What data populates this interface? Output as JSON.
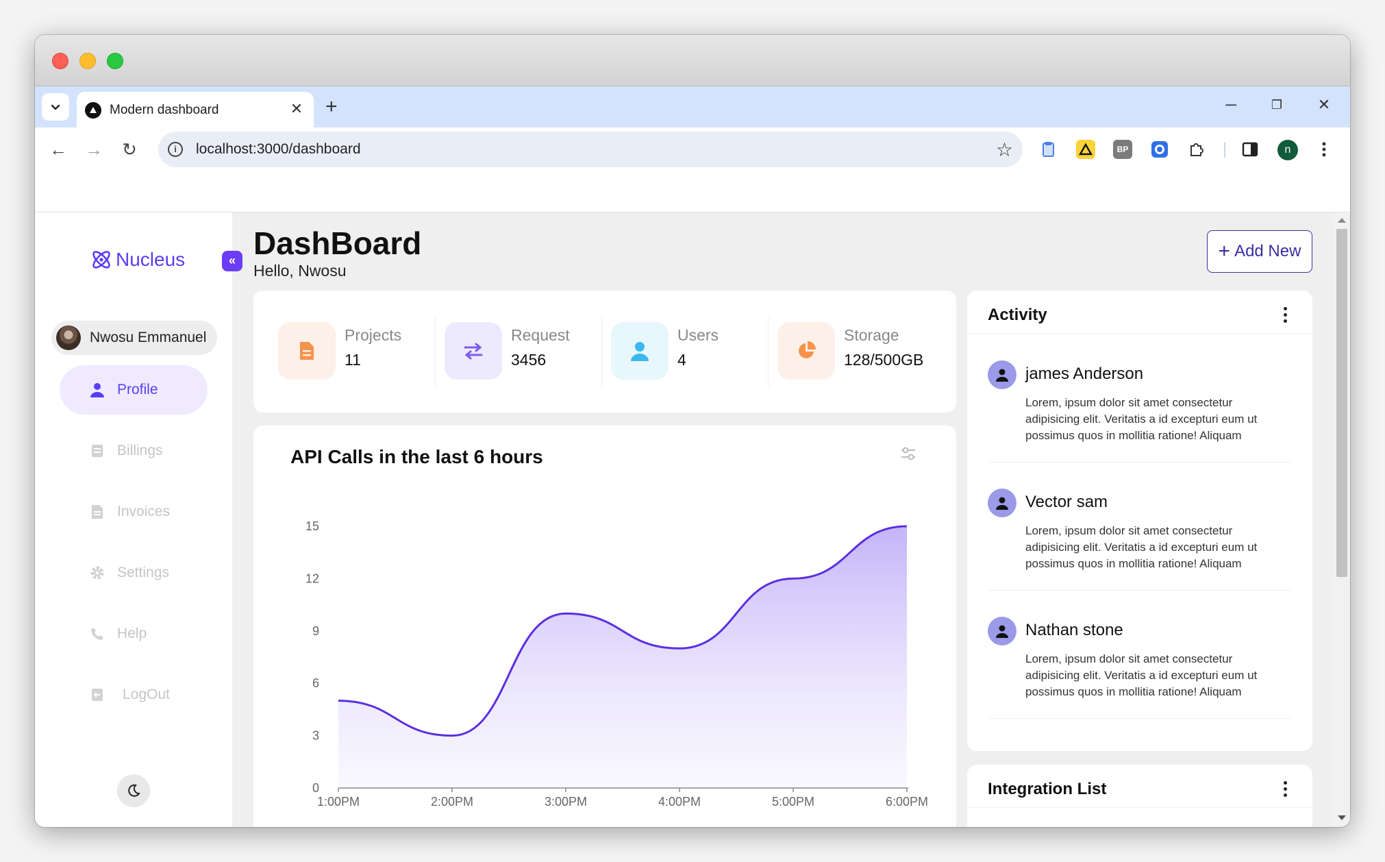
{
  "browser": {
    "tab_title": "Modern dashboard",
    "new_tab": "+",
    "url": "localhost:3000/dashboard",
    "profile_initial": "n",
    "ext_bp": "BP"
  },
  "sidebar": {
    "logo": "Nucleus",
    "collapse": "«",
    "user_name": "Nwosu Emmanuel",
    "items": [
      {
        "label": "Profile",
        "icon": "user-icon",
        "active": true
      },
      {
        "label": "Billings",
        "icon": "billing-icon",
        "active": false
      },
      {
        "label": "Invoices",
        "icon": "invoice-icon",
        "active": false
      },
      {
        "label": "Settings",
        "icon": "gear-icon",
        "active": false
      },
      {
        "label": "Help",
        "icon": "phone-icon",
        "active": false
      },
      {
        "label": "LogOut",
        "icon": "logout-icon",
        "active": false
      }
    ]
  },
  "header": {
    "title": "DashBoard",
    "greeting": "Hello, Nwosu",
    "add_button": "Add New"
  },
  "stats": [
    {
      "label": "Projects",
      "value": "11",
      "icon": "document-icon",
      "color": "#f5934a",
      "bg": "#fdf0e8"
    },
    {
      "label": "Request",
      "value": "3456",
      "icon": "transfer-icon",
      "color": "#7c5cf0",
      "bg": "#eeeafd"
    },
    {
      "label": "Users",
      "value": "4",
      "icon": "user-icon",
      "color": "#3bb8ee",
      "bg": "#e8f6fd"
    },
    {
      "label": "Storage",
      "value": "128/500GB",
      "icon": "pie-chart-icon",
      "color": "#f5934a",
      "bg": "#fdf0e8"
    }
  ],
  "chart_data": {
    "type": "area",
    "title": "API Calls in the last 6 hours",
    "categories": [
      "1:00PM",
      "2:00PM",
      "3:00PM",
      "4:00PM",
      "5:00PM",
      "6:00PM"
    ],
    "values": [
      5,
      3,
      10,
      8,
      12,
      15
    ],
    "yticks": [
      0,
      3,
      6,
      9,
      12,
      15
    ],
    "ylim": [
      0,
      15
    ],
    "color": "#5b2ee0"
  },
  "activity": {
    "title": "Activity",
    "items": [
      {
        "name": "james Anderson",
        "text": "Lorem, ipsum dolor sit amet consectetur adipisicing elit. Veritatis a id excepturi eum ut possimus quos in mollitia ratione! Aliquam"
      },
      {
        "name": "Vector sam",
        "text": "Lorem, ipsum dolor sit amet consectetur adipisicing elit. Veritatis a id excepturi eum ut possimus quos in mollitia ratione! Aliquam"
      },
      {
        "name": "Nathan stone",
        "text": "Lorem, ipsum dolor sit amet consectetur adipisicing elit. Veritatis a id excepturi eum ut possimus quos in mollitia ratione! Aliquam"
      }
    ]
  },
  "integration": {
    "title": "Integration List"
  }
}
